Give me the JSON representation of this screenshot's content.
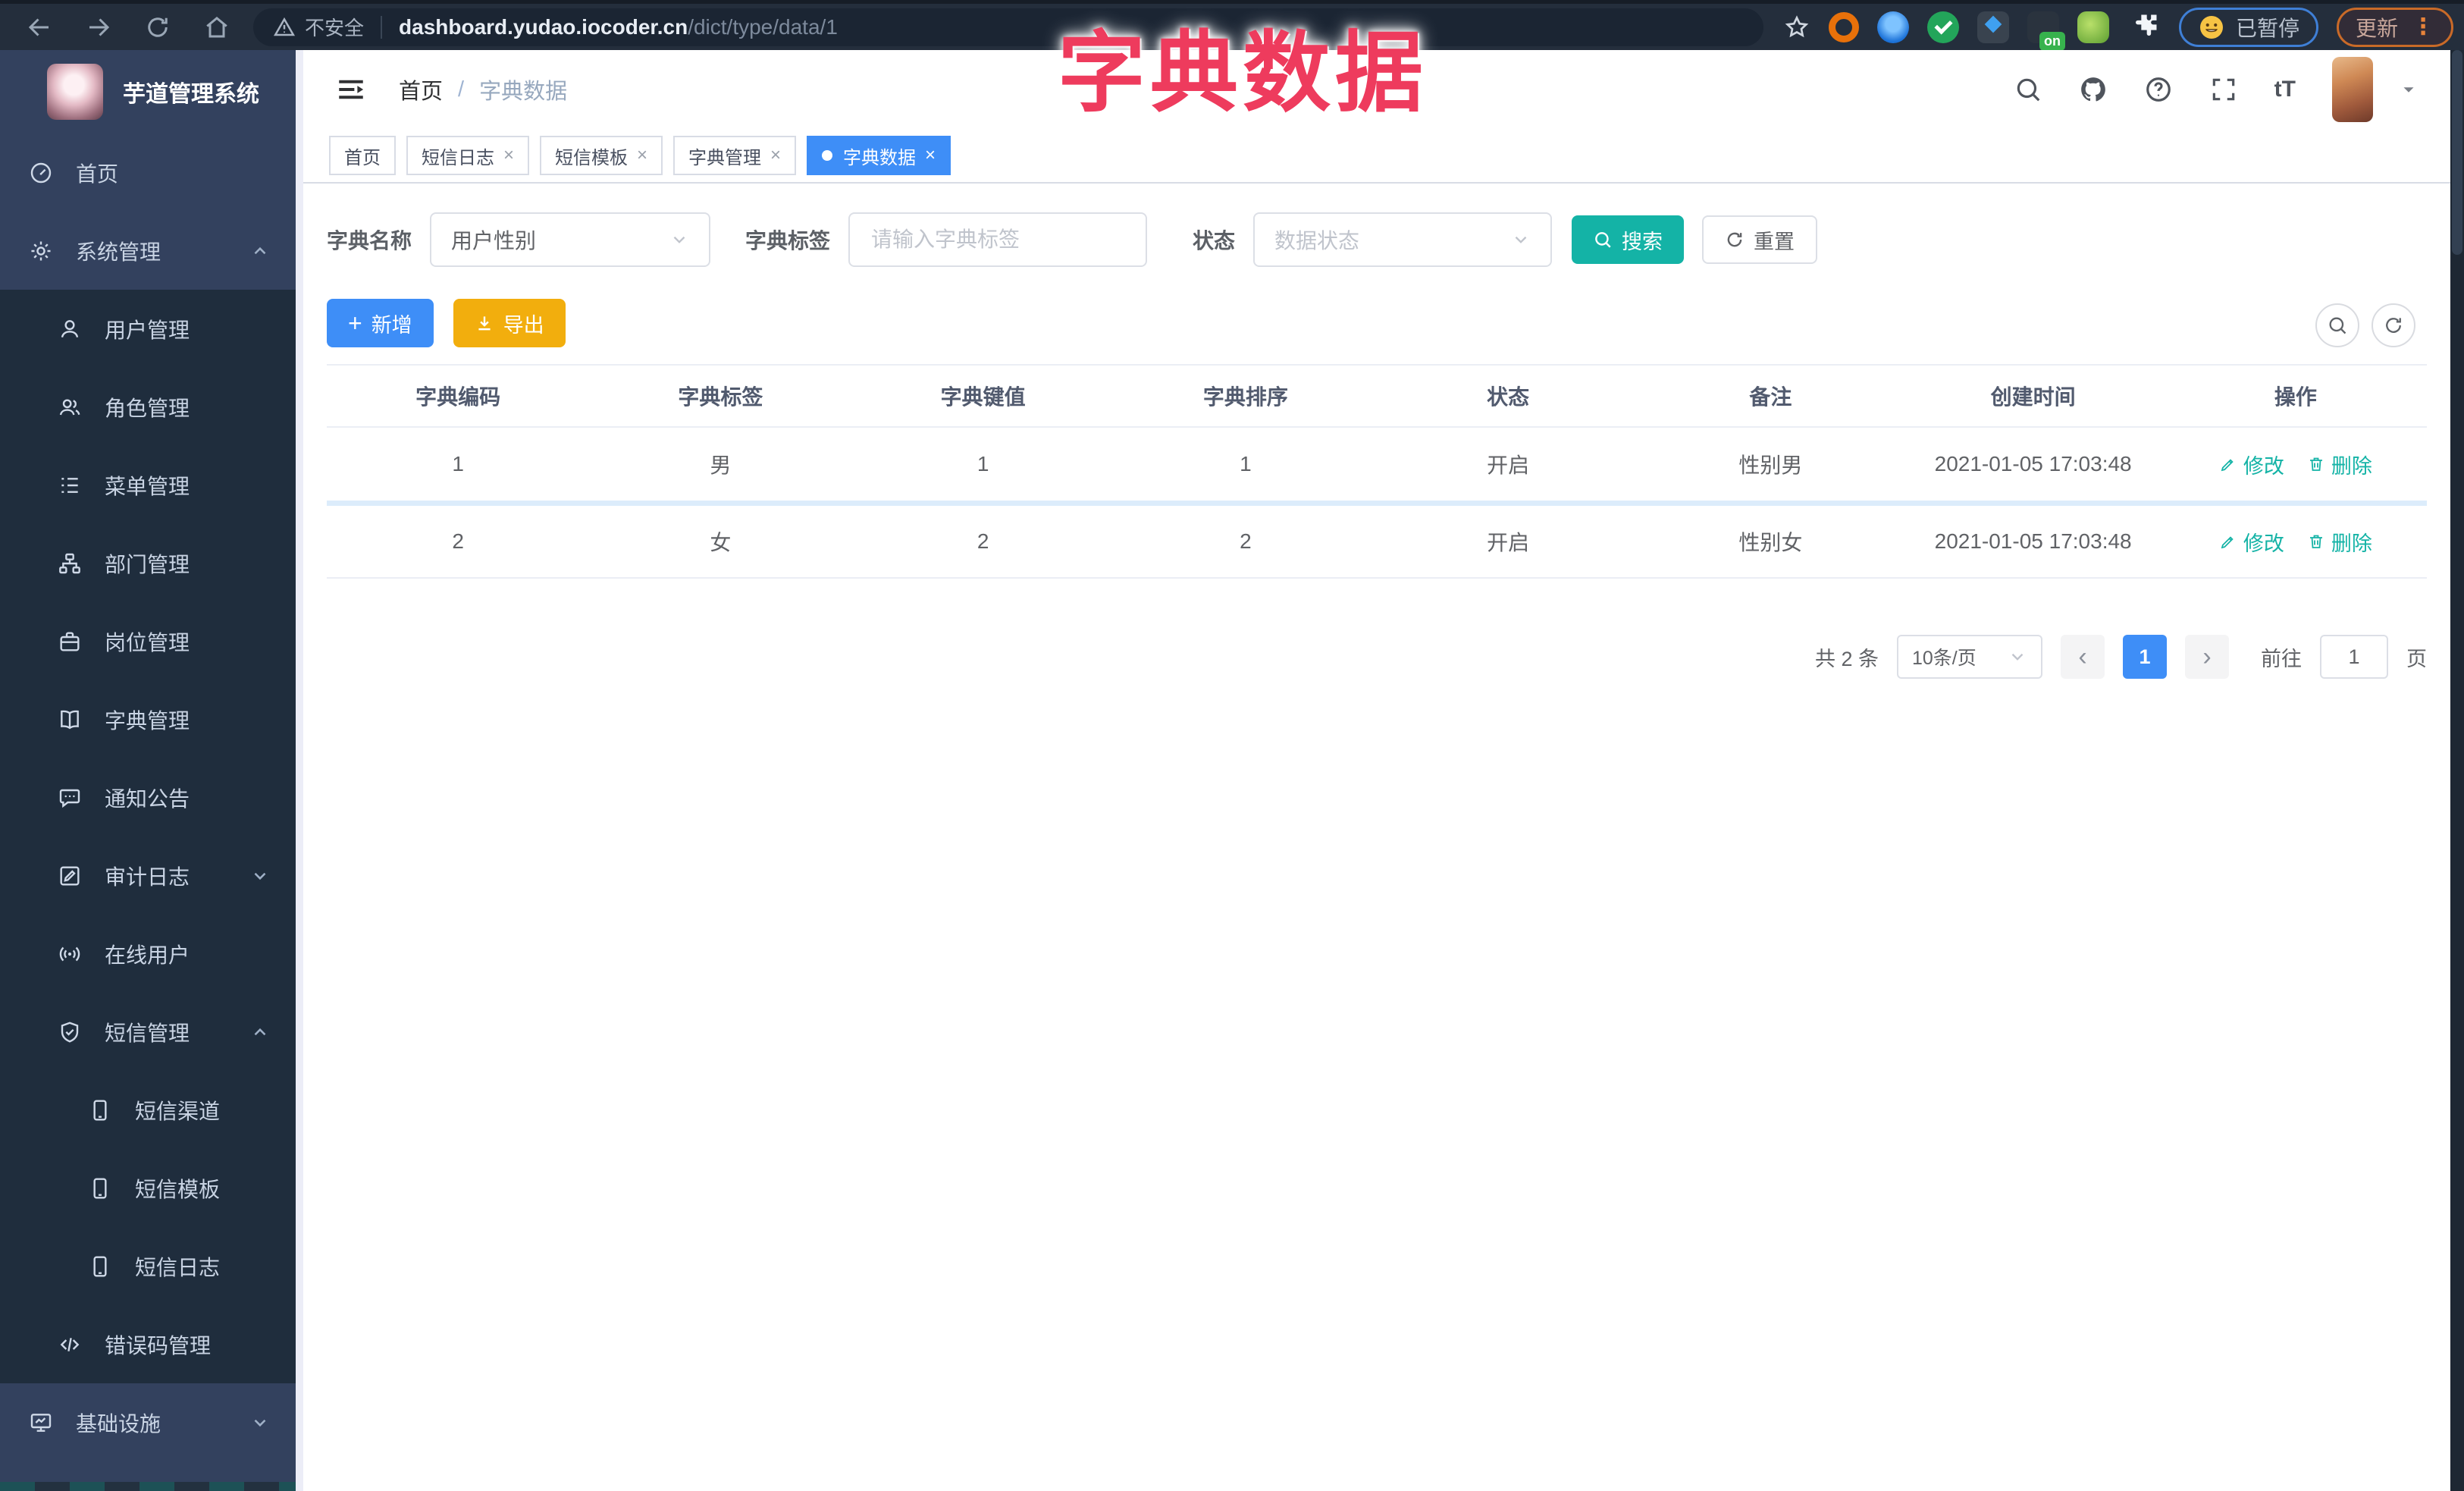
{
  "browser": {
    "security_label": "不安全",
    "url_host": "dashboard.yudao.iocoder.cn",
    "url_path": "/dict/type/data/1",
    "extension_on_badge": "on",
    "paused_badge": "已暂停",
    "update_button": "更新",
    "menu_dots": "⋮"
  },
  "overlay": {
    "title": "字典数据"
  },
  "sidebar": {
    "logo_title": "芋道管理系统",
    "items": [
      {
        "label": "首页",
        "icon": "dashboard",
        "level": 1
      },
      {
        "label": "系统管理",
        "icon": "gear",
        "level": 1,
        "chevron": "up"
      },
      {
        "label": "用户管理",
        "icon": "user",
        "level": 2
      },
      {
        "label": "角色管理",
        "icon": "users",
        "level": 2
      },
      {
        "label": "菜单管理",
        "icon": "list",
        "level": 2
      },
      {
        "label": "部门管理",
        "icon": "org-tree",
        "level": 2
      },
      {
        "label": "岗位管理",
        "icon": "briefcase",
        "level": 2
      },
      {
        "label": "字典管理",
        "icon": "book",
        "level": 2
      },
      {
        "label": "通知公告",
        "icon": "chat",
        "level": 2
      },
      {
        "label": "审计日志",
        "icon": "edit-doc",
        "level": 2,
        "chevron": "down"
      },
      {
        "label": "在线用户",
        "icon": "broadcast",
        "level": 2
      },
      {
        "label": "短信管理",
        "icon": "shield-check",
        "level": 2,
        "chevron": "up"
      },
      {
        "label": "短信渠道",
        "icon": "phone",
        "level": 3
      },
      {
        "label": "短信模板",
        "icon": "phone",
        "level": 3
      },
      {
        "label": "短信日志",
        "icon": "phone",
        "level": 3
      },
      {
        "label": "错误码管理",
        "icon": "code",
        "level": 2
      },
      {
        "label": "基础设施",
        "icon": "monitor",
        "level": 1,
        "chevron": "down"
      }
    ]
  },
  "header": {
    "breadcrumb": [
      "首页",
      "字典数据"
    ],
    "breadcrumb_separator": "/",
    "font_size_icon_label": "tT"
  },
  "tabs": [
    {
      "label": "首页",
      "closable": false,
      "active": false
    },
    {
      "label": "短信日志",
      "closable": true,
      "active": false
    },
    {
      "label": "短信模板",
      "closable": true,
      "active": false
    },
    {
      "label": "字典管理",
      "closable": true,
      "active": false
    },
    {
      "label": "字典数据",
      "closable": true,
      "active": true
    }
  ],
  "tab_close_glyph": "×",
  "filters": {
    "dict_name_label": "字典名称",
    "dict_name_value": "用户性别",
    "dict_label_label": "字典标签",
    "dict_label_placeholder": "请输入字典标签",
    "status_label": "状态",
    "status_placeholder": "数据状态",
    "search_button": "搜索",
    "reset_button": "重置"
  },
  "toolbar": {
    "add_button": "新增",
    "add_plus": "+",
    "export_button": "导出"
  },
  "table": {
    "headers": [
      "字典编码",
      "字典标签",
      "字典键值",
      "字典排序",
      "状态",
      "备注",
      "创建时间",
      "操作"
    ],
    "rows": [
      {
        "code": "1",
        "label": "男",
        "value": "1",
        "sort": "1",
        "status": "开启",
        "remark": "性别男",
        "created": "2021-01-05 17:03:48"
      },
      {
        "code": "2",
        "label": "女",
        "value": "2",
        "sort": "2",
        "status": "开启",
        "remark": "性别女",
        "created": "2021-01-05 17:03:48"
      }
    ],
    "edit_label": "修改",
    "delete_label": "删除"
  },
  "pagination": {
    "total": "共 2 条",
    "page_size": "10条/页",
    "prev_glyph": "‹",
    "current_page": "1",
    "next_glyph": "›",
    "goto_label": "前往",
    "goto_value": "1",
    "page_unit": "页"
  },
  "colors": {
    "primary_blue": "#3e8ef7",
    "teal_accent": "#14b3a6",
    "warning_yellow": "#f2ae0d",
    "overlay_red": "#ee3b5d",
    "sidebar_bg": "#33415e",
    "submenu_bg": "#1f2d3d",
    "browser_bar_bg": "#242e3c"
  }
}
